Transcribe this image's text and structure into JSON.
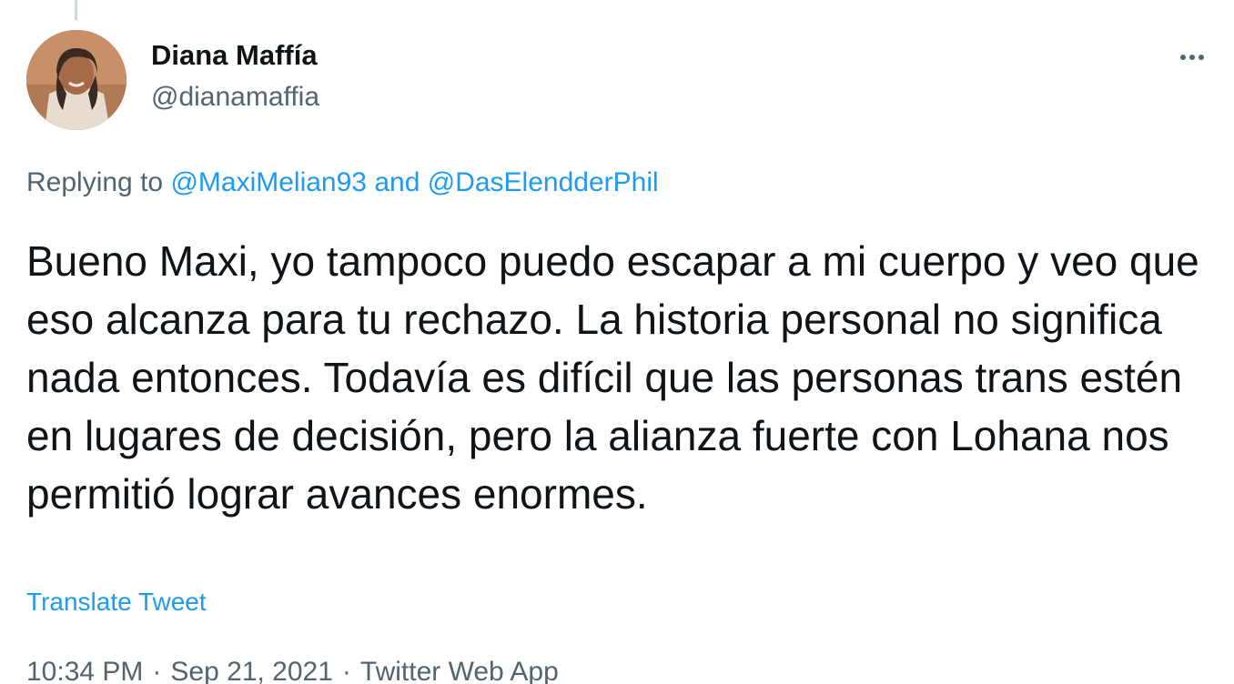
{
  "author": {
    "display_name": "Diana Maffía",
    "handle": "@dianamaffia"
  },
  "more_icon": "more-horizontal-icon",
  "reply_context": {
    "prefix": "Replying to",
    "mentions": [
      "@MaxiMelian93",
      "@DasElendderPhil"
    ],
    "conjunction": "and"
  },
  "tweet_text": "Bueno Maxi, yo tampoco puedo escapar a mi cuerpo y veo que eso alcanza para tu rechazo. La historia personal no significa nada entonces. Todavía es difícil que las personas trans estén en lugares de decisión, pero la alianza fuerte con Lohana nos permitió lograr avances enormes.",
  "translate_label": "Translate Tweet",
  "meta": {
    "time": "10:34 PM",
    "date": "Sep 21, 2021",
    "source": "Twitter Web App",
    "separator": "·"
  },
  "colors": {
    "link": "#1d9bf0",
    "secondary": "#536471",
    "primary_text": "#0f1419"
  }
}
